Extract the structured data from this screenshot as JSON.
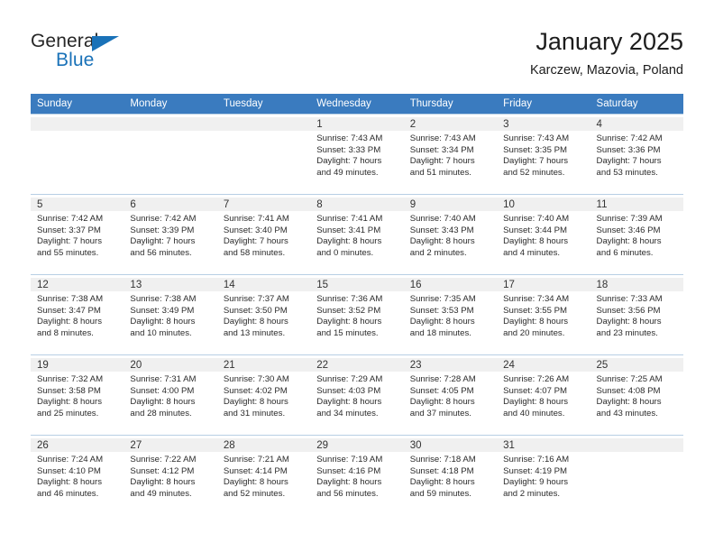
{
  "brand": {
    "name_part1": "General",
    "name_part2": "Blue",
    "triangle_color": "#1a72b8"
  },
  "header": {
    "title": "January 2025",
    "subtitle": "Karczew, Mazovia, Poland"
  },
  "theme": {
    "header_row_bg": "#3a7bbf",
    "daynum_bg": "#f0f0f0",
    "grid_line": "#b8cfe4",
    "text": "#2b2b2b"
  },
  "weekday_headers": [
    "Sunday",
    "Monday",
    "Tuesday",
    "Wednesday",
    "Thursday",
    "Friday",
    "Saturday"
  ],
  "weeks": [
    [
      {
        "day": "",
        "sunrise": "",
        "sunset": "",
        "daylight1": "",
        "daylight2": "",
        "empty": true
      },
      {
        "day": "",
        "sunrise": "",
        "sunset": "",
        "daylight1": "",
        "daylight2": "",
        "empty": true
      },
      {
        "day": "",
        "sunrise": "",
        "sunset": "",
        "daylight1": "",
        "daylight2": "",
        "empty": true
      },
      {
        "day": "1",
        "sunrise": "Sunrise: 7:43 AM",
        "sunset": "Sunset: 3:33 PM",
        "daylight1": "Daylight: 7 hours",
        "daylight2": "and 49 minutes.",
        "empty": false
      },
      {
        "day": "2",
        "sunrise": "Sunrise: 7:43 AM",
        "sunset": "Sunset: 3:34 PM",
        "daylight1": "Daylight: 7 hours",
        "daylight2": "and 51 minutes.",
        "empty": false
      },
      {
        "day": "3",
        "sunrise": "Sunrise: 7:43 AM",
        "sunset": "Sunset: 3:35 PM",
        "daylight1": "Daylight: 7 hours",
        "daylight2": "and 52 minutes.",
        "empty": false
      },
      {
        "day": "4",
        "sunrise": "Sunrise: 7:42 AM",
        "sunset": "Sunset: 3:36 PM",
        "daylight1": "Daylight: 7 hours",
        "daylight2": "and 53 minutes.",
        "empty": false
      }
    ],
    [
      {
        "day": "5",
        "sunrise": "Sunrise: 7:42 AM",
        "sunset": "Sunset: 3:37 PM",
        "daylight1": "Daylight: 7 hours",
        "daylight2": "and 55 minutes.",
        "empty": false
      },
      {
        "day": "6",
        "sunrise": "Sunrise: 7:42 AM",
        "sunset": "Sunset: 3:39 PM",
        "daylight1": "Daylight: 7 hours",
        "daylight2": "and 56 minutes.",
        "empty": false
      },
      {
        "day": "7",
        "sunrise": "Sunrise: 7:41 AM",
        "sunset": "Sunset: 3:40 PM",
        "daylight1": "Daylight: 7 hours",
        "daylight2": "and 58 minutes.",
        "empty": false
      },
      {
        "day": "8",
        "sunrise": "Sunrise: 7:41 AM",
        "sunset": "Sunset: 3:41 PM",
        "daylight1": "Daylight: 8 hours",
        "daylight2": "and 0 minutes.",
        "empty": false
      },
      {
        "day": "9",
        "sunrise": "Sunrise: 7:40 AM",
        "sunset": "Sunset: 3:43 PM",
        "daylight1": "Daylight: 8 hours",
        "daylight2": "and 2 minutes.",
        "empty": false
      },
      {
        "day": "10",
        "sunrise": "Sunrise: 7:40 AM",
        "sunset": "Sunset: 3:44 PM",
        "daylight1": "Daylight: 8 hours",
        "daylight2": "and 4 minutes.",
        "empty": false
      },
      {
        "day": "11",
        "sunrise": "Sunrise: 7:39 AM",
        "sunset": "Sunset: 3:46 PM",
        "daylight1": "Daylight: 8 hours",
        "daylight2": "and 6 minutes.",
        "empty": false
      }
    ],
    [
      {
        "day": "12",
        "sunrise": "Sunrise: 7:38 AM",
        "sunset": "Sunset: 3:47 PM",
        "daylight1": "Daylight: 8 hours",
        "daylight2": "and 8 minutes.",
        "empty": false
      },
      {
        "day": "13",
        "sunrise": "Sunrise: 7:38 AM",
        "sunset": "Sunset: 3:49 PM",
        "daylight1": "Daylight: 8 hours",
        "daylight2": "and 10 minutes.",
        "empty": false
      },
      {
        "day": "14",
        "sunrise": "Sunrise: 7:37 AM",
        "sunset": "Sunset: 3:50 PM",
        "daylight1": "Daylight: 8 hours",
        "daylight2": "and 13 minutes.",
        "empty": false
      },
      {
        "day": "15",
        "sunrise": "Sunrise: 7:36 AM",
        "sunset": "Sunset: 3:52 PM",
        "daylight1": "Daylight: 8 hours",
        "daylight2": "and 15 minutes.",
        "empty": false
      },
      {
        "day": "16",
        "sunrise": "Sunrise: 7:35 AM",
        "sunset": "Sunset: 3:53 PM",
        "daylight1": "Daylight: 8 hours",
        "daylight2": "and 18 minutes.",
        "empty": false
      },
      {
        "day": "17",
        "sunrise": "Sunrise: 7:34 AM",
        "sunset": "Sunset: 3:55 PM",
        "daylight1": "Daylight: 8 hours",
        "daylight2": "and 20 minutes.",
        "empty": false
      },
      {
        "day": "18",
        "sunrise": "Sunrise: 7:33 AM",
        "sunset": "Sunset: 3:56 PM",
        "daylight1": "Daylight: 8 hours",
        "daylight2": "and 23 minutes.",
        "empty": false
      }
    ],
    [
      {
        "day": "19",
        "sunrise": "Sunrise: 7:32 AM",
        "sunset": "Sunset: 3:58 PM",
        "daylight1": "Daylight: 8 hours",
        "daylight2": "and 25 minutes.",
        "empty": false
      },
      {
        "day": "20",
        "sunrise": "Sunrise: 7:31 AM",
        "sunset": "Sunset: 4:00 PM",
        "daylight1": "Daylight: 8 hours",
        "daylight2": "and 28 minutes.",
        "empty": false
      },
      {
        "day": "21",
        "sunrise": "Sunrise: 7:30 AM",
        "sunset": "Sunset: 4:02 PM",
        "daylight1": "Daylight: 8 hours",
        "daylight2": "and 31 minutes.",
        "empty": false
      },
      {
        "day": "22",
        "sunrise": "Sunrise: 7:29 AM",
        "sunset": "Sunset: 4:03 PM",
        "daylight1": "Daylight: 8 hours",
        "daylight2": "and 34 minutes.",
        "empty": false
      },
      {
        "day": "23",
        "sunrise": "Sunrise: 7:28 AM",
        "sunset": "Sunset: 4:05 PM",
        "daylight1": "Daylight: 8 hours",
        "daylight2": "and 37 minutes.",
        "empty": false
      },
      {
        "day": "24",
        "sunrise": "Sunrise: 7:26 AM",
        "sunset": "Sunset: 4:07 PM",
        "daylight1": "Daylight: 8 hours",
        "daylight2": "and 40 minutes.",
        "empty": false
      },
      {
        "day": "25",
        "sunrise": "Sunrise: 7:25 AM",
        "sunset": "Sunset: 4:08 PM",
        "daylight1": "Daylight: 8 hours",
        "daylight2": "and 43 minutes.",
        "empty": false
      }
    ],
    [
      {
        "day": "26",
        "sunrise": "Sunrise: 7:24 AM",
        "sunset": "Sunset: 4:10 PM",
        "daylight1": "Daylight: 8 hours",
        "daylight2": "and 46 minutes.",
        "empty": false
      },
      {
        "day": "27",
        "sunrise": "Sunrise: 7:22 AM",
        "sunset": "Sunset: 4:12 PM",
        "daylight1": "Daylight: 8 hours",
        "daylight2": "and 49 minutes.",
        "empty": false
      },
      {
        "day": "28",
        "sunrise": "Sunrise: 7:21 AM",
        "sunset": "Sunset: 4:14 PM",
        "daylight1": "Daylight: 8 hours",
        "daylight2": "and 52 minutes.",
        "empty": false
      },
      {
        "day": "29",
        "sunrise": "Sunrise: 7:19 AM",
        "sunset": "Sunset: 4:16 PM",
        "daylight1": "Daylight: 8 hours",
        "daylight2": "and 56 minutes.",
        "empty": false
      },
      {
        "day": "30",
        "sunrise": "Sunrise: 7:18 AM",
        "sunset": "Sunset: 4:18 PM",
        "daylight1": "Daylight: 8 hours",
        "daylight2": "and 59 minutes.",
        "empty": false
      },
      {
        "day": "31",
        "sunrise": "Sunrise: 7:16 AM",
        "sunset": "Sunset: 4:19 PM",
        "daylight1": "Daylight: 9 hours",
        "daylight2": "and 2 minutes.",
        "empty": false
      },
      {
        "day": "",
        "sunrise": "",
        "sunset": "",
        "daylight1": "",
        "daylight2": "",
        "empty": true
      }
    ]
  ]
}
